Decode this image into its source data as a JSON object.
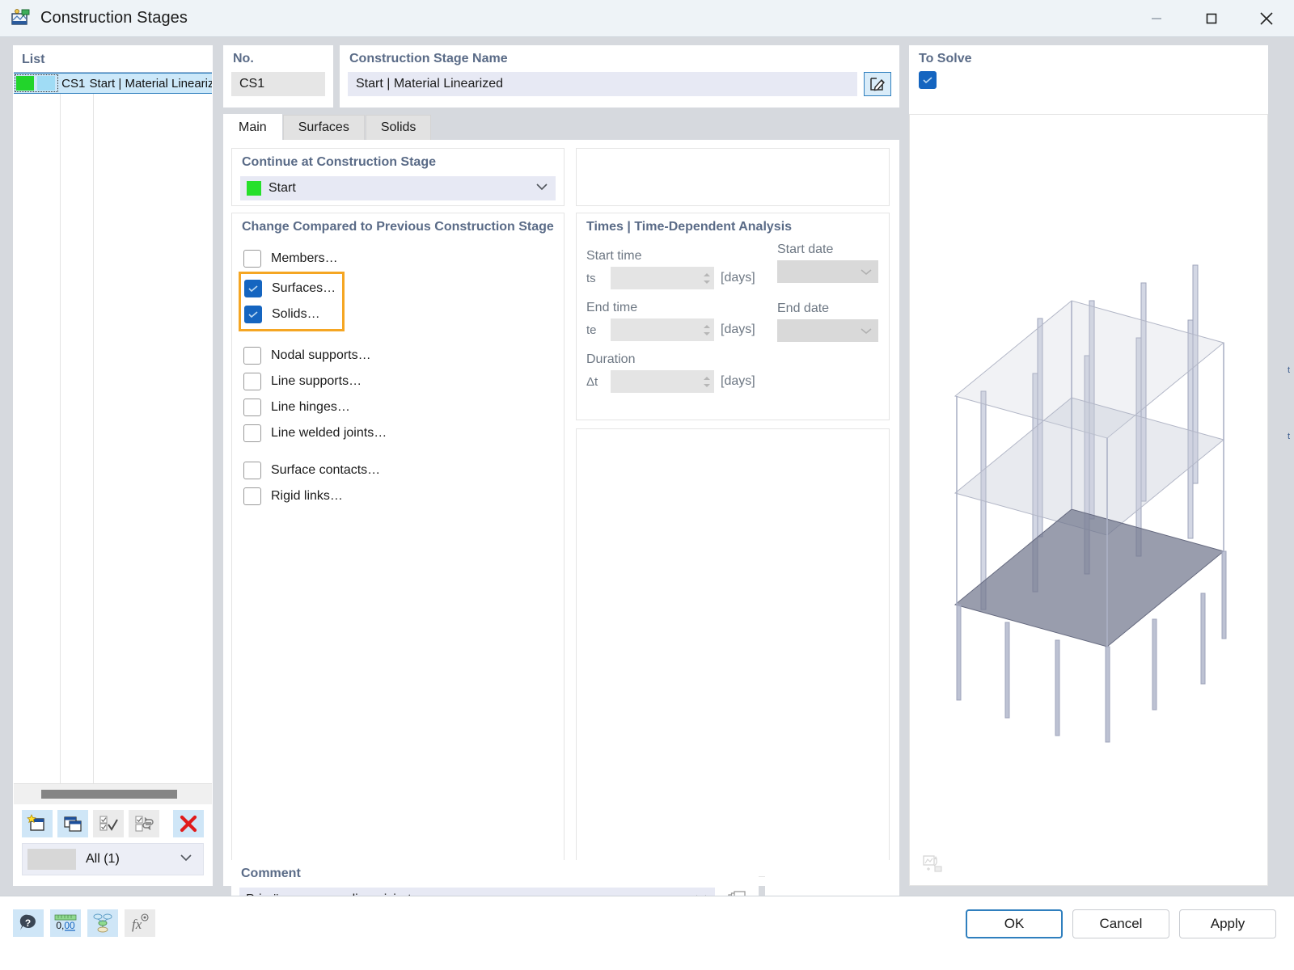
{
  "window": {
    "title": "Construction Stages",
    "app_icon": "construction-stages-icon",
    "minimize_label": "Minimize",
    "maximize_label": "Maximize",
    "close_label": "Close"
  },
  "list_panel": {
    "label": "List",
    "columns": [
      "color",
      "no",
      "name"
    ],
    "rows": [
      {
        "color_primary": "#22d42b",
        "color_secondary": "#a0dcf5",
        "no": "CS1",
        "name": "Start | Material Lineariz",
        "selected": true
      }
    ],
    "toolbar": [
      {
        "name": "new-construction-stage",
        "icon": "new-item-icon",
        "enabled": true
      },
      {
        "name": "copy-construction-stage",
        "icon": "copy-item-icon",
        "enabled": true
      },
      {
        "name": "select-all",
        "icon": "check-all-icon",
        "enabled": false
      },
      {
        "name": "invert-selection",
        "icon": "invert-selection-icon",
        "enabled": false
      },
      {
        "name": "delete-construction-stage",
        "icon": "delete-red-x-icon",
        "enabled": true
      }
    ],
    "filter": {
      "label": "All (1)",
      "swatch": "#d7d7d7"
    },
    "scrollbar": {
      "orientation": "horizontal"
    }
  },
  "no_group": {
    "label": "No.",
    "value": "CS1"
  },
  "name_group": {
    "label": "Construction Stage Name",
    "value": "Start | Material Linearized",
    "edit_button_icon": "pencil-edit-icon"
  },
  "to_solve": {
    "label": "To Solve",
    "checked": true
  },
  "tabs": [
    {
      "label": "Main",
      "active": true
    },
    {
      "label": "Surfaces",
      "active": false
    },
    {
      "label": "Solids",
      "active": false
    }
  ],
  "continue_group": {
    "title": "Continue at Construction Stage",
    "selected": "Start",
    "swatch_color": "#26e02b"
  },
  "change_group": {
    "title": "Change Compared to Previous Construction Stage",
    "items": [
      {
        "label": "Members…",
        "checked": false,
        "highlighted": false
      },
      {
        "label": "Surfaces…",
        "checked": true,
        "highlighted": true
      },
      {
        "label": "Solids…",
        "checked": true,
        "highlighted": true
      },
      {
        "label": "Nodal supports…",
        "checked": false,
        "highlighted": false
      },
      {
        "label": "Line supports…",
        "checked": false,
        "highlighted": false
      },
      {
        "label": "Line hinges…",
        "checked": false,
        "highlighted": false
      },
      {
        "label": "Line welded joints…",
        "checked": false,
        "highlighted": false
      },
      {
        "label": "Surface contacts…",
        "checked": false,
        "highlighted": false
      },
      {
        "label": "Rigid links…",
        "checked": false,
        "highlighted": false
      }
    ],
    "highlight_color": "#f5a623"
  },
  "times_group": {
    "title": "Times | Time-Dependent Analysis",
    "start_time": {
      "label": "Start time",
      "symbol": "ts",
      "value": "",
      "unit": "[days]",
      "enabled": false
    },
    "end_time": {
      "label": "End time",
      "symbol": "te",
      "value": "",
      "unit": "[days]",
      "enabled": false
    },
    "duration": {
      "label": "Duration",
      "symbol": "Δt",
      "value": "",
      "unit": "[days]",
      "enabled": false
    },
    "start_date": {
      "label": "Start date",
      "value": "",
      "enabled": false
    },
    "end_date": {
      "label": "End date",
      "value": "",
      "enabled": false
    }
  },
  "comment_group": {
    "label": "Comment",
    "value": "Primärspannung - linearisiert",
    "copy_icon": "copy-pages-icon",
    "dropdown_icon": "chevron-down-icon"
  },
  "viewport": {
    "model_name": "3d-building-model",
    "bottom_icon": "render-mode-icon"
  },
  "footer": {
    "tools": [
      {
        "name": "help-button",
        "icon": "help-bubble-icon",
        "enabled": true
      },
      {
        "name": "number-format-button",
        "icon": "number-format-icon",
        "label": "0,00",
        "enabled": true
      },
      {
        "name": "units-button",
        "icon": "units-icon",
        "enabled": true
      },
      {
        "name": "formula-button",
        "icon": "fx-icon",
        "enabled": false
      }
    ],
    "buttons": [
      {
        "label": "OK",
        "name": "ok-button",
        "primary": true
      },
      {
        "label": "Cancel",
        "name": "cancel-button",
        "primary": false
      },
      {
        "label": "Apply",
        "name": "apply-button",
        "primary": false
      }
    ]
  },
  "colors": {
    "accent_blue": "#1565c0",
    "highlight_orange": "#f5a623",
    "panel_title": "#5a6b87",
    "window_bg": "#d6d9de",
    "field_bg": "#e7e9f4",
    "disabled_bg": "#e4e4e4"
  }
}
